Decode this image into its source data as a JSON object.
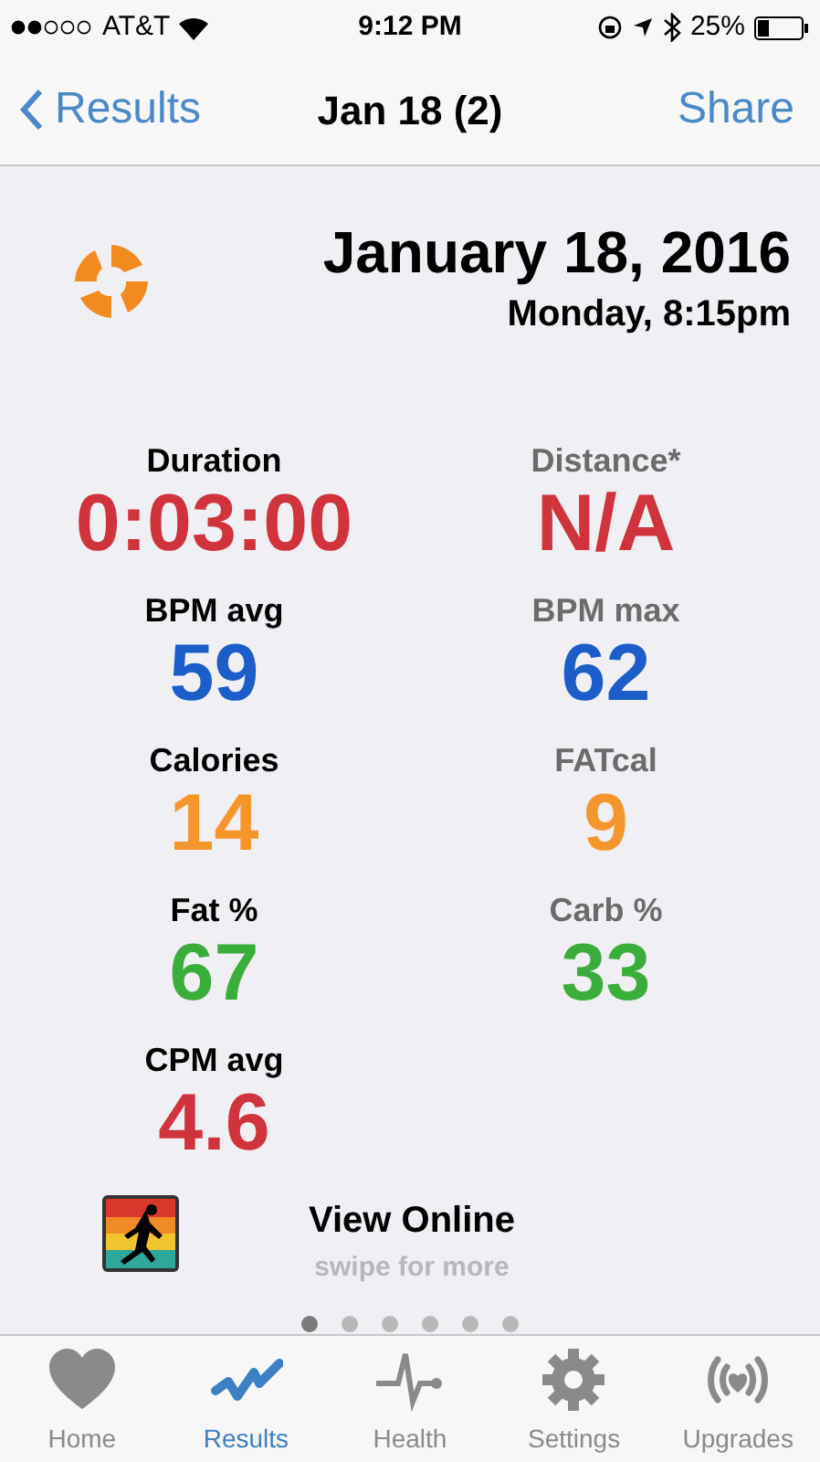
{
  "status_bar": {
    "carrier": "AT&T",
    "time": "9:12 PM",
    "battery": "25%"
  },
  "nav": {
    "back": "Results",
    "title": "Jan 18 (2)",
    "action": "Share"
  },
  "header": {
    "date": "January 18, 2016",
    "time": "Monday, 8:15pm"
  },
  "metrics": [
    {
      "label": "Duration",
      "value": "0:03:00",
      "color": "#d0333c"
    },
    {
      "label": "Distance*",
      "value": "N/A",
      "color": "#d0333c"
    },
    {
      "label": "BPM avg",
      "value": "59",
      "color": "#1c5ec9"
    },
    {
      "label": "BPM max",
      "value": "62",
      "color": "#1c5ec9"
    },
    {
      "label": "Calories",
      "value": "14",
      "color": "#f5962c"
    },
    {
      "label": "FATcal",
      "value": "9",
      "color": "#f5962c"
    },
    {
      "label": "Fat %",
      "value": "67",
      "color": "#3aae3a"
    },
    {
      "label": "Carb %",
      "value": "33",
      "color": "#3aae3a"
    },
    {
      "label": "CPM avg",
      "value": "4.6",
      "color": "#d0333c"
    }
  ],
  "link": {
    "title": "View Online",
    "subtitle": "swipe for more"
  },
  "pages": [
    {
      "selected": true
    },
    {
      "selected": false
    },
    {
      "selected": false
    },
    {
      "selected": false
    },
    {
      "selected": false
    },
    {
      "selected": false
    }
  ],
  "tabs": [
    {
      "label": "Home",
      "kind": "heart",
      "selected": false
    },
    {
      "label": "Results",
      "kind": "graph",
      "selected": true
    },
    {
      "label": "Health",
      "kind": "pulse",
      "selected": false
    },
    {
      "label": "Settings",
      "kind": "gear",
      "selected": false
    },
    {
      "label": "Upgrades",
      "kind": "signal",
      "selected": false
    }
  ]
}
